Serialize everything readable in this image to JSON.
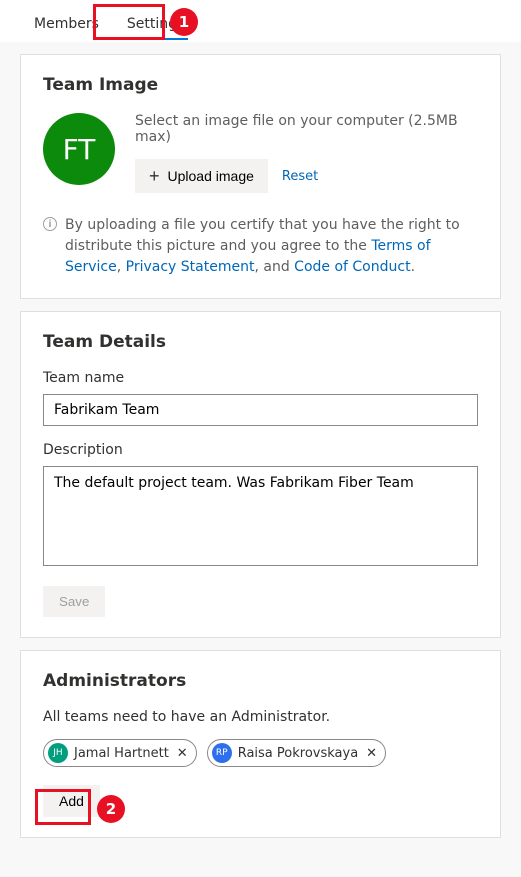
{
  "tabs": {
    "members": "Members",
    "settings": "Settings"
  },
  "teamImage": {
    "heading": "Team Image",
    "initials": "FT",
    "hint": "Select an image file on your computer (2.5MB max)",
    "uploadLabel": "Upload image",
    "resetLabel": "Reset",
    "legalPrefix": "By uploading a file you certify that you have the right to distribute this picture and you agree to the ",
    "tosLabel": "Terms of Service",
    "comma1": ", ",
    "privacyLabel": "Privacy Statement",
    "comma2": ", and ",
    "cocLabel": "Code of Conduct",
    "period": "."
  },
  "teamDetails": {
    "heading": "Team Details",
    "nameLabel": "Team name",
    "nameValue": "Fabrikam Team",
    "descLabel": "Description",
    "descValue": "The default project team. Was Fabrikam Fiber Team",
    "saveLabel": "Save"
  },
  "admins": {
    "heading": "Administrators",
    "desc": "All teams need to have an Administrator.",
    "list": [
      {
        "initials": "JH",
        "name": "Jamal Hartnett",
        "color": "#009e7e"
      },
      {
        "initials": "RP",
        "name": "Raisa Pokrovskaya",
        "color": "#2f6fed"
      }
    ],
    "addLabel": "Add"
  },
  "callouts": {
    "one": "1",
    "two": "2"
  }
}
